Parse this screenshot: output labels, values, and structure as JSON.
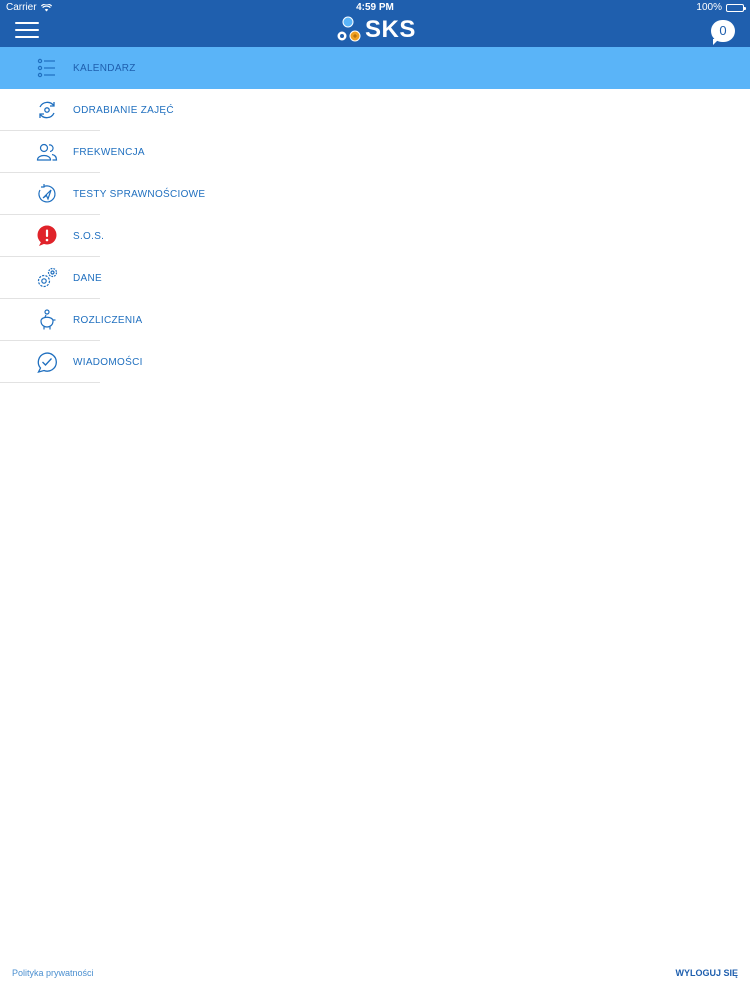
{
  "status_bar": {
    "carrier": "Carrier",
    "time": "4:59 PM",
    "battery": "100%"
  },
  "header": {
    "logo_text": "SKS",
    "message_count": "0",
    "bar_color": "#1f5fae"
  },
  "menu": {
    "active_color": "#5ab4f8",
    "items": [
      {
        "label": "KALENDARZ",
        "icon": "list-icon",
        "active": true
      },
      {
        "label": "ODRABIANIE ZAJĘĆ",
        "icon": "refresh-circle-icon",
        "active": false
      },
      {
        "label": "FREKWENCJA",
        "icon": "users-icon",
        "active": false
      },
      {
        "label": "TESTY SPRAWNOŚCIOWE",
        "icon": "compass-icon",
        "active": false
      },
      {
        "label": "S.O.S.",
        "icon": "alert-icon",
        "active": false
      },
      {
        "label": "DANE",
        "icon": "gears-icon",
        "active": false
      },
      {
        "label": "ROZLICZENIA",
        "icon": "piggy-bank-icon",
        "active": false
      },
      {
        "label": "WIADOMOŚCI",
        "icon": "message-check-icon",
        "active": false
      }
    ]
  },
  "footer": {
    "privacy_link": "Polityka prywatności",
    "logout_button": "WYLOGUJ SIĘ"
  }
}
